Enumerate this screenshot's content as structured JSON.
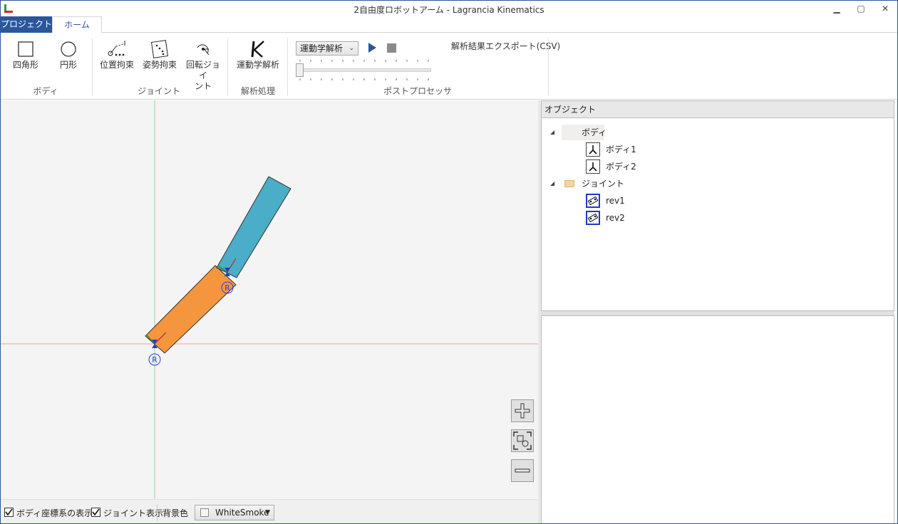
{
  "window": {
    "title": "2自由度ロボットアーム - Lagrancia Kinematics"
  },
  "tabs": {
    "project": "プロジェクト",
    "home": "ホーム"
  },
  "ribbon": {
    "body": {
      "rect": "四角形",
      "circle": "円形",
      "group": "ボディ"
    },
    "joint": {
      "position": "位置拘束",
      "posture": "姿勢拘束",
      "revolute_1": "回転ジョイ",
      "revolute_2": "ント",
      "group": "ジョイント"
    },
    "analysis": {
      "kinematics": "運動学解析",
      "group": "解析処理"
    },
    "post": {
      "mode_value": "運動学解析",
      "export": "解析結果エクスポート(CSV)",
      "group": "ポストプロセッサ",
      "progress": 0
    }
  },
  "canvas": {
    "joint_marker_1": "R",
    "joint_marker_2": "R",
    "body1_color": "#f5963f",
    "body2_color": "#4aaec8"
  },
  "bottom": {
    "show_body_coords": "ボディ座標系の表示",
    "show_joints": "ジョイント表示",
    "bg_label": "背景色",
    "bg_value": "WhiteSmoke"
  },
  "objects": {
    "header": "オブジェクト",
    "body_folder": "ボディ",
    "bodies": [
      "ボディ1",
      "ボディ2"
    ],
    "joint_folder": "ジョイント",
    "joints": [
      "rev1",
      "rev2"
    ]
  }
}
